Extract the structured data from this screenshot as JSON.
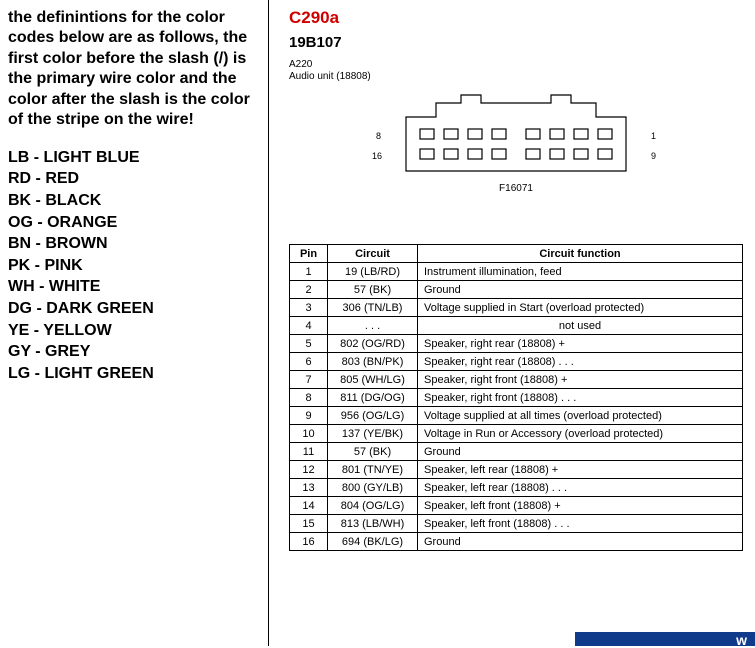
{
  "left": {
    "intro": "the definintions for the color codes below are as follows,  the first color before the slash (/) is the primary wire color and the color after the slash is the color of the stripe on the wire!",
    "legend": [
      "LB - LIGHT BLUE",
      "RD - RED",
      "BK - BLACK",
      "OG - ORANGE",
      "BN - BROWN",
      "PK - PINK",
      "WH - WHITE",
      "DG - DARK GREEN",
      "YE - YELLOW",
      "GY - GREY",
      "LG - LIGHT GREEN"
    ]
  },
  "right": {
    "connector_id": "C290a",
    "part_number": "19B107",
    "sub1": "A220",
    "sub2": "Audio unit (18808)",
    "figure": "F16071",
    "pins": {
      "p8": "8",
      "p1": "1",
      "p16": "16",
      "p9": "9"
    },
    "table_headers": {
      "pin": "Pin",
      "circuit": "Circuit",
      "func": "Circuit function"
    },
    "rows": [
      {
        "pin": "1",
        "circuit": "19 (LB/RD)",
        "func": "Instrument illumination, feed"
      },
      {
        "pin": "2",
        "circuit": "57 (BK)",
        "func": "Ground"
      },
      {
        "pin": "3",
        "circuit": "306 (TN/LB)",
        "func": "Voltage supplied in Start (overload protected)"
      },
      {
        "pin": "4",
        "circuit": ".  .  .",
        "func": "not used"
      },
      {
        "pin": "5",
        "circuit": "802 (OG/RD)",
        "func": "Speaker, right rear (18808) +"
      },
      {
        "pin": "6",
        "circuit": "803 (BN/PK)",
        "func": "Speaker, right rear (18808) .  .  ."
      },
      {
        "pin": "7",
        "circuit": "805 (WH/LG)",
        "func": "Speaker, right front (18808) +"
      },
      {
        "pin": "8",
        "circuit": "811 (DG/OG)",
        "func": "Speaker, right front (18808) .  .  ."
      },
      {
        "pin": "9",
        "circuit": "956 (OG/LG)",
        "func": "Voltage supplied at all times (overload protected)"
      },
      {
        "pin": "10",
        "circuit": "137 (YE/BK)",
        "func": "Voltage in Run or Accessory (overload protected)"
      },
      {
        "pin": "11",
        "circuit": "57 (BK)",
        "func": "Ground"
      },
      {
        "pin": "12",
        "circuit": "801 (TN/YE)",
        "func": "Speaker, left rear (18808) +"
      },
      {
        "pin": "13",
        "circuit": "800 (GY/LB)",
        "func": "Speaker, left rear (18808) .  .  ."
      },
      {
        "pin": "14",
        "circuit": "804 (OG/LG)",
        "func": "Speaker, left front (18808) +"
      },
      {
        "pin": "15",
        "circuit": "813 (LB/WH)",
        "func": "Speaker, left front (18808) .  .  ."
      },
      {
        "pin": "16",
        "circuit": "694 (BK/LG)",
        "func": "Ground"
      }
    ]
  },
  "footer_char": "w"
}
